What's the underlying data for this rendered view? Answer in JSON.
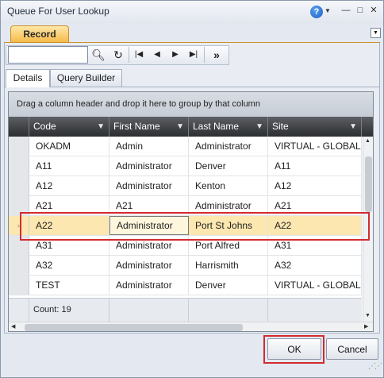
{
  "window": {
    "title": "Queue For User Lookup"
  },
  "ribbon": {
    "tab_label": "Record"
  },
  "toolbar": {
    "search_value": ""
  },
  "tabs": [
    {
      "label": "Details"
    },
    {
      "label": "Query Builder"
    }
  ],
  "grid": {
    "group_hint": "Drag a column header and drop it here to group by that column",
    "columns": [
      "Code",
      "First Name",
      "Last Name",
      "Site"
    ],
    "rows": [
      [
        "OKADM",
        "Admin",
        "Administrator",
        "VIRTUAL - GLOBAL"
      ],
      [
        "A11",
        "Administrator",
        "Denver",
        "A11"
      ],
      [
        "A12",
        "Administrator",
        "Kenton",
        "A12"
      ],
      [
        "A21",
        "A21",
        "Administrator",
        "A21"
      ],
      [
        "A22",
        "Administrator",
        "Port St Johns",
        "A22"
      ],
      [
        "A31",
        "Administrator",
        "Port Alfred",
        "A31"
      ],
      [
        "A32",
        "Administrator",
        "Harrismith",
        "A32"
      ],
      [
        "TEST",
        "Administrator",
        "Denver",
        "VIRTUAL - GLOBAL"
      ]
    ],
    "selected_row_index": 4,
    "count_label": "Count: 19"
  },
  "buttons": {
    "ok": "OK",
    "cancel": "Cancel"
  },
  "colors": {
    "accent_tab": "#f5b944",
    "selected_row": "#fde7b0",
    "highlight": "#d22b30",
    "header": "#3a3c3f"
  }
}
